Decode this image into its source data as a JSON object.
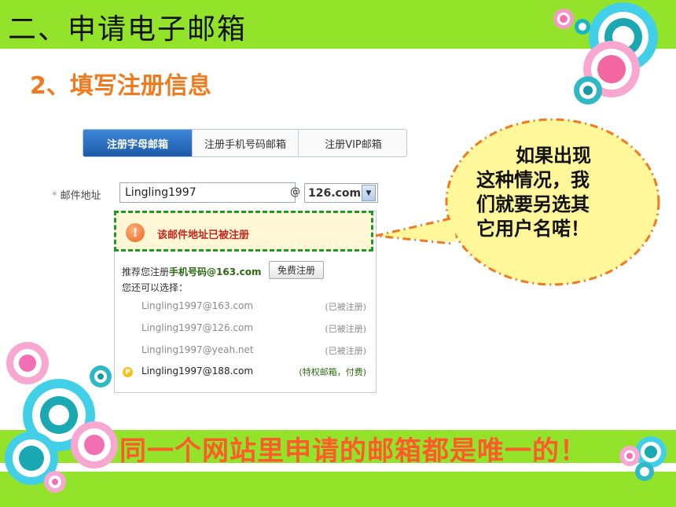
{
  "slide": {
    "title": "二、申请电子邮箱",
    "subtitle": "2、填写注册信息",
    "bottom_note": "同一个网站里申请的邮箱都是唯一的！"
  },
  "tabs": [
    {
      "label": "注册字母邮箱",
      "active": true
    },
    {
      "label": "注册手机号码邮箱",
      "active": false
    },
    {
      "label": "注册VIP邮箱",
      "active": false
    }
  ],
  "form": {
    "required_mark": "*",
    "email_label": "邮件地址",
    "email_value": "Lingling1997",
    "at": "@",
    "domain_selected": "126.com"
  },
  "dropdown": {
    "warning_icon": "!",
    "warning_text": "该邮件地址已被注册",
    "recommend_prefix": "推荐您注册",
    "recommend_bold": "手机号码",
    "recommend_suffix": "@163.com",
    "free_button": "免费注册",
    "choose_label": "您还可以选择：",
    "options": [
      {
        "address": "Lingling1997@163.com",
        "status": "(已被注册)"
      },
      {
        "address": "Lingling1997@126.com",
        "status": "(已被注册)"
      },
      {
        "address": "Lingling1997@yeah.net",
        "status": "(已被注册)"
      },
      {
        "address": "Lingling1997@188.com",
        "status": "(特权邮箱，付费)",
        "vip_icon": "P"
      }
    ]
  },
  "callout": {
    "lines": [
      "如果出现",
      "这种情况，我",
      "们就要另选其",
      "它用户名喏！"
    ]
  },
  "colors": {
    "band": "#93e32a",
    "subtitle": "#f07a1e",
    "bottom_text": "#ff5a2a",
    "callout_fill": "#fff79a",
    "callout_border": "#f07a1e"
  }
}
